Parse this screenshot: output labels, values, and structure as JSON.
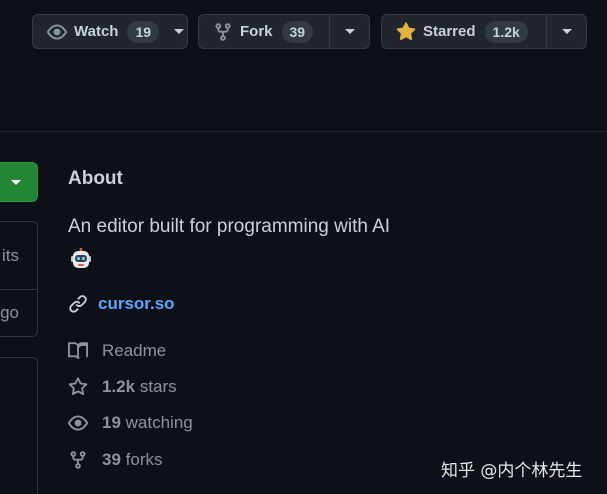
{
  "repo_actions": {
    "watch": {
      "label": "Watch",
      "count": "19"
    },
    "fork": {
      "label": "Fork",
      "count": "39"
    },
    "star": {
      "label": "Starred",
      "count": "1.2k"
    }
  },
  "left_panel": {
    "row1_text": "its",
    "row2_text": "go"
  },
  "about": {
    "title": "About",
    "description": "An editor built for programming with AI",
    "emoji_icon": "robot-face-icon",
    "link": "cursor.so",
    "readme": "Readme",
    "stars_count": "1.2k",
    "stars_label": " stars",
    "watching_count": "19",
    "watching_label": " watching",
    "forks_count": "39",
    "forks_label": " forks"
  },
  "watermark": "知乎 @内个林先生",
  "colors": {
    "background": "#0d1117",
    "button_bg": "#21262d",
    "link": "#58a6ff",
    "star_gold": "#e3b341",
    "green_button": "#238636"
  }
}
